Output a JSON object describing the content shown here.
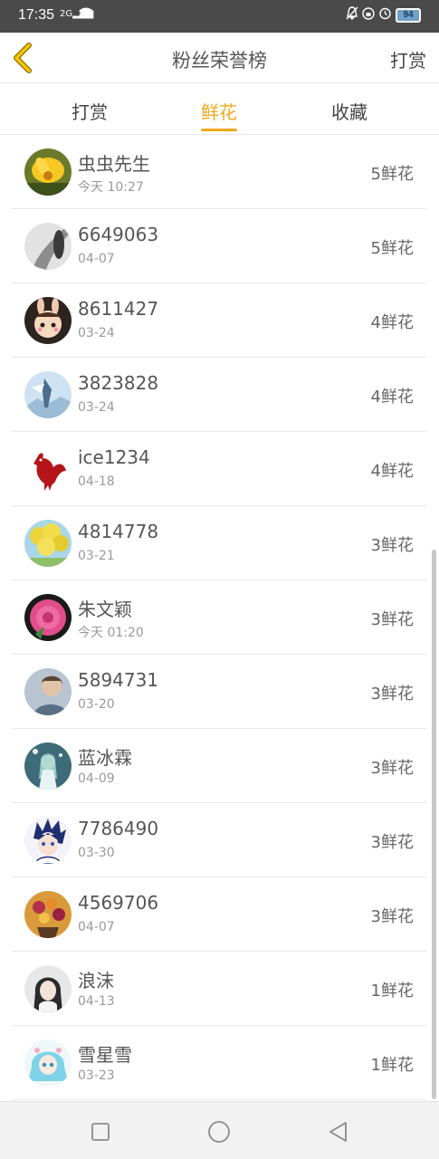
{
  "status_bar": {
    "time": "17:35",
    "signal": "2G",
    "battery": "94"
  },
  "header": {
    "title": "粉丝荣誉榜",
    "action_label": "打赏"
  },
  "tabs": [
    {
      "label": "打赏",
      "active": false
    },
    {
      "label": "鲜花",
      "active": true
    },
    {
      "label": "收藏",
      "active": false
    }
  ],
  "accent_color": "#f0a81b",
  "fans": [
    {
      "name": "虫虫先生",
      "time": "今天 10:27",
      "count": "5鲜花",
      "avatar": "sunflower-avatar"
    },
    {
      "name": "6649063",
      "time": "04-07",
      "count": "5鲜花",
      "avatar": "gray-figure-avatar"
    },
    {
      "name": "8611427",
      "time": "03-24",
      "count": "4鲜花",
      "avatar": "bunny-character-avatar"
    },
    {
      "name": "3823828",
      "time": "03-24",
      "count": "4鲜花",
      "avatar": "ice-figure-avatar"
    },
    {
      "name": "ice1234",
      "time": "04-18",
      "count": "4鲜花",
      "avatar": "red-rooster-avatar"
    },
    {
      "name": "4814778",
      "time": "03-21",
      "count": "3鲜花",
      "avatar": "yellow-balloons-avatar"
    },
    {
      "name": "朱文颖",
      "time": "今天 01:20",
      "count": "3鲜花",
      "avatar": "pink-rose-avatar"
    },
    {
      "name": "5894731",
      "time": "03-20",
      "count": "3鲜花",
      "avatar": "portrait-avatar"
    },
    {
      "name": "蓝冰霖",
      "time": "04-09",
      "count": "3鲜花",
      "avatar": "anime-girl-avatar"
    },
    {
      "name": "7786490",
      "time": "03-30",
      "count": "3鲜花",
      "avatar": "anime-boy-avatar"
    },
    {
      "name": "4569706",
      "time": "04-07",
      "count": "3鲜花",
      "avatar": "flower-bouquet-avatar"
    },
    {
      "name": "浪沫",
      "time": "04-13",
      "count": "1鲜花",
      "avatar": "girl-portrait-avatar"
    },
    {
      "name": "雪星雪",
      "time": "03-23",
      "count": "1鲜花",
      "avatar": "blue-anime-avatar"
    }
  ],
  "system_nav": [
    "recent-apps-icon",
    "home-icon",
    "back-icon"
  ]
}
